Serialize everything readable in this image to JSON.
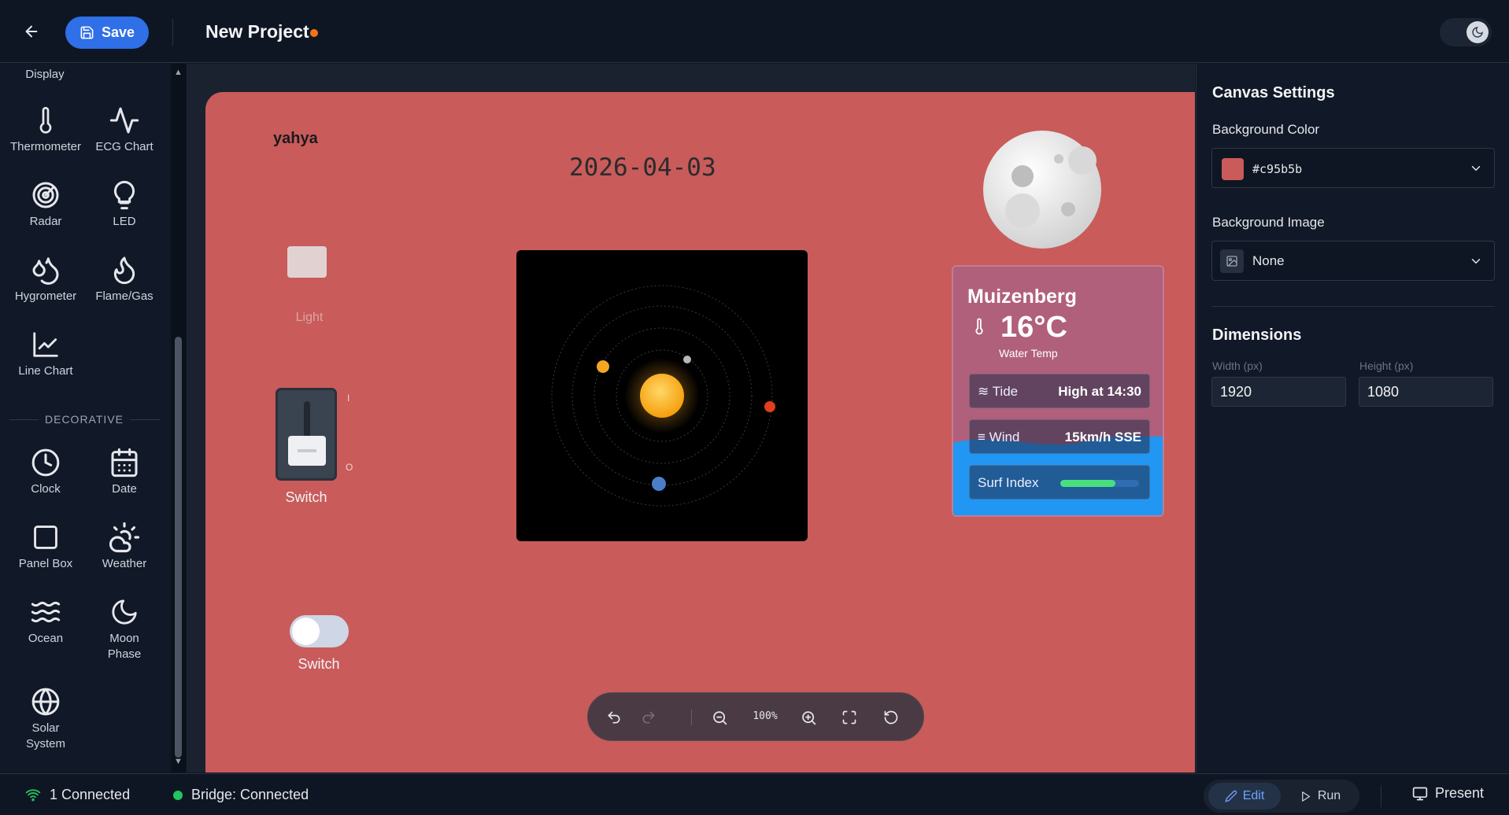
{
  "header": {
    "save_label": "Save",
    "project_title": "New Project"
  },
  "sidebar": {
    "partial_top_label": "Display",
    "components": [
      {
        "label": "Thermometer",
        "icon": "thermometer-icon"
      },
      {
        "label": "ECG Chart",
        "icon": "ecg-icon"
      },
      {
        "label": "Radar",
        "icon": "radar-icon"
      },
      {
        "label": "LED",
        "icon": "bulb-icon"
      },
      {
        "label": "Hygrometer",
        "icon": "droplets-icon"
      },
      {
        "label": "Flame/Gas",
        "icon": "flame-icon"
      },
      {
        "label": "Line Chart",
        "icon": "line-chart-icon"
      }
    ],
    "section_label": "DECORATIVE",
    "decorative": [
      {
        "label": "Clock",
        "icon": "clock-icon"
      },
      {
        "label": "Date",
        "icon": "calendar-icon"
      },
      {
        "label": "Panel Box",
        "icon": "square-icon"
      },
      {
        "label": "Weather",
        "icon": "cloud-sun-icon"
      },
      {
        "label": "Ocean",
        "icon": "waves-icon"
      },
      {
        "label": "Moon Phase",
        "icon": "moon-icon"
      },
      {
        "label": "Solar System",
        "icon": "globe-icon"
      }
    ]
  },
  "canvas": {
    "background_color": "#c95b5b",
    "name_text": "yahya",
    "date_text": "2026-04-03",
    "light_label": "Light",
    "switch_label": "Switch",
    "switch_on_mark": "I",
    "switch_off_mark": "O",
    "toggle_label": "Switch",
    "toggle_on": false,
    "weather": {
      "city": "Muizenberg",
      "temp": "16°C",
      "sub": "Water Temp",
      "tide_label": "Tide",
      "tide_value": "High at 14:30",
      "wind_label": "Wind",
      "wind_value": "15km/h SSE",
      "surf_label": "Surf Index",
      "surf_index_fraction": 0.7
    }
  },
  "zoom": {
    "level": "100%"
  },
  "panel": {
    "title": "Canvas Settings",
    "bg_color_label": "Background Color",
    "bg_color_value": "#c95b5b",
    "bg_image_label": "Background Image",
    "bg_image_value": "None",
    "dimensions_title": "Dimensions",
    "width_label": "Width (px)",
    "width_value": "1920",
    "height_label": "Height (px)",
    "height_value": "1080"
  },
  "status": {
    "connected": "1 Connected",
    "bridge": "Bridge: Connected",
    "edit_label": "Edit",
    "run_label": "Run",
    "present_label": "Present"
  }
}
